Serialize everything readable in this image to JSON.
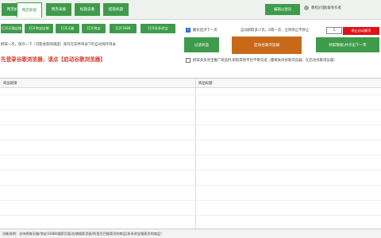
{
  "tabs": [
    {
      "label": "网页抓取",
      "active": false
    },
    {
      "label": "网店抓取",
      "active": true
    },
    {
      "label": "网页采集",
      "active": false
    },
    {
      "label": "标题去重",
      "active": false
    },
    {
      "label": "提取标题",
      "active": false
    }
  ],
  "header": {
    "batch_button": "编辑过滤词",
    "help_link": "教程|问题|联系作者"
  },
  "toolbar": {
    "buttons": [
      "打开天猫店铺",
      "打开淘宝店铺",
      "打开天猫",
      "打开淘宝",
      "打开1688",
      "打开多多进宝"
    ],
    "notice": "抓取一次，保存一下（可能会影响速度）保存在软件目录下的自动保存目录",
    "red_hint": "先登录谷歌浏览器，请点【启动谷歌浏览器】"
  },
  "options": {
    "auto_next_label": "翻页后点下一页",
    "auto_next_checked": true,
    "pages_text": "自动抓取多少页，0或一次，立刻停止不停止",
    "pages_value": "1",
    "stop_button": "停止自动翻页",
    "filter_button": "过滤商品",
    "launch_button": "启动谷歌浏览器",
    "grab_button": "抓取数据,并点击下一页",
    "duplicate_label": "抓取多多进宝推广商品时,抓取其他平台不要勾选（都要关闭谷歌浏览器，在启动谷歌浏览器）",
    "duplicate_checked": false
  },
  "table": {
    "columns": [
      "商品链接",
      "商品标题"
    ]
  },
  "status": {
    "text": "功能说明：支持抓取天猫/淘宝/1688/搜索页面/店铺搜索页面/阿里巴巴搜索页的商品/多多进宝搜索页的商品!"
  },
  "colors": {
    "accent": "#3f9b4b",
    "launch": "#c8691a",
    "stop": "#e0101a",
    "grab": "#3f9b4b",
    "red_text": "#d43a2a"
  }
}
